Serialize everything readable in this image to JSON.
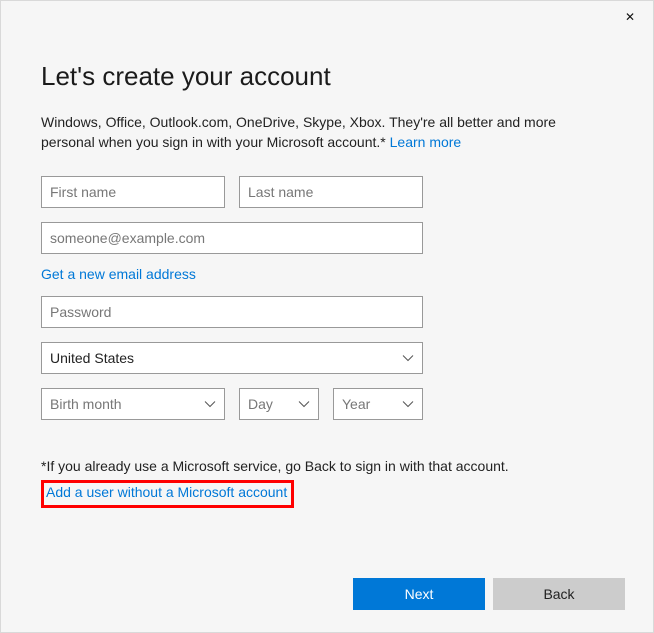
{
  "window": {
    "close_icon": "✕"
  },
  "heading": "Let's create your account",
  "intro": {
    "text": "Windows, Office, Outlook.com, OneDrive, Skype, Xbox. They're all better and more personal when you sign in with your Microsoft account.* ",
    "learn_more": "Learn more"
  },
  "fields": {
    "first_name_placeholder": "First name",
    "last_name_placeholder": "Last name",
    "email_placeholder": "someone@example.com",
    "get_new_label": "Get a new email address",
    "password_placeholder": "Password",
    "country_selected": "United States",
    "month_selected": "Birth month",
    "day_selected": "Day",
    "year_selected": "Year"
  },
  "footnote": "*If you already use a Microsoft service, go Back to sign in with that account.",
  "alt_link": "Add a user without a Microsoft account",
  "buttons": {
    "next": "Next",
    "back": "Back"
  }
}
